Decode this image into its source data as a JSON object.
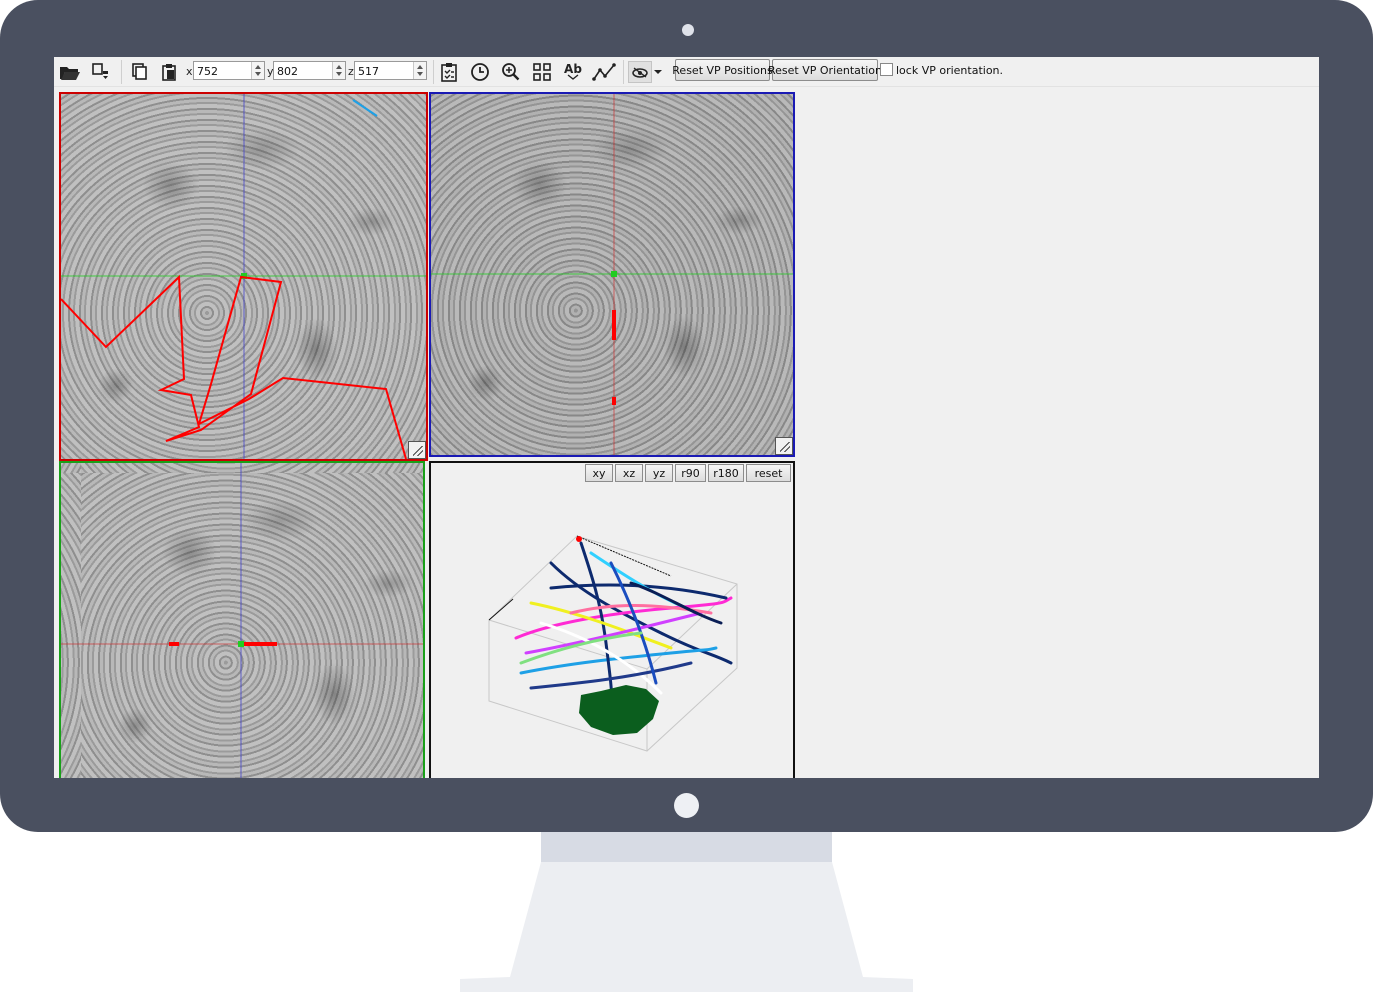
{
  "toolbar": {
    "x_label": "x",
    "x_value": "752",
    "y_label": "y",
    "y_value": "802",
    "z_label": "z",
    "z_value": "517",
    "text_tool_label": "Ab",
    "reset_positions_label": "Reset VP Positions",
    "reset_orientation_label": "Reset VP Orientation",
    "lock_orientation_label": "lock VP orientation.",
    "lock_orientation_checked": false,
    "icons": [
      "open-folder-icon",
      "save-dropdown-icon",
      "copy-icon",
      "paste-icon",
      "task-clipboard-icon",
      "clock-icon",
      "zoom-icon",
      "grid-icon",
      "text-icon",
      "skeleton-path-icon",
      "eye-toggle-icon",
      "dropdown-arrow-icon"
    ]
  },
  "viewports": {
    "xy": {
      "border_color": "#cc0000"
    },
    "xz": {
      "border_color": "#1a1ab4"
    },
    "yz": {
      "border_color": "#19a019"
    },
    "3d": {
      "border_color": "#111111"
    }
  },
  "vp3d_buttons": [
    "xy",
    "xz",
    "yz",
    "r90",
    "r180",
    "reset"
  ],
  "colors": {
    "monitor_bezel": "#4a5060",
    "skeleton": "#ff0000",
    "crosshair_green": "#22cc22",
    "crosshair_blue": "#4444cc",
    "mesh_green": "#0b5e1e"
  }
}
